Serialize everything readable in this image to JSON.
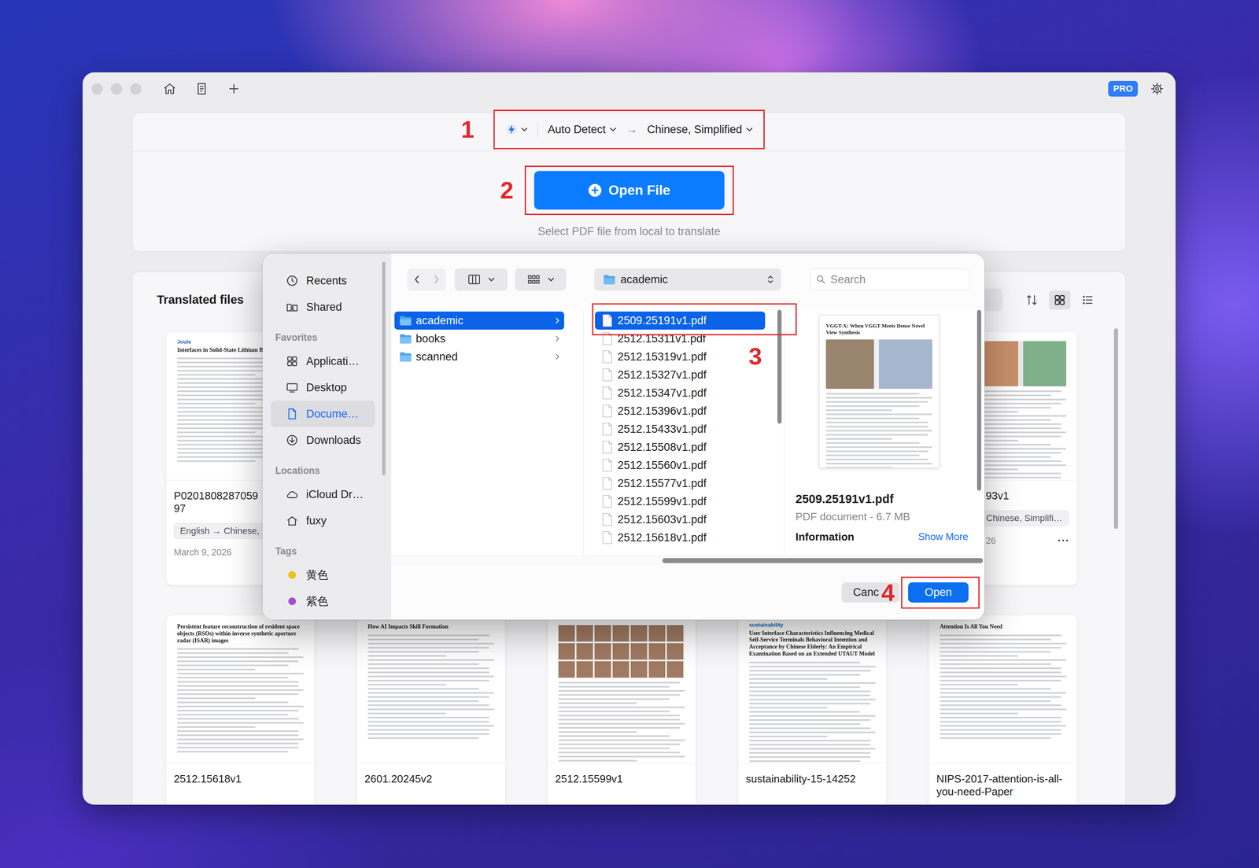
{
  "app": {
    "badge": "PRO"
  },
  "translator": {
    "source_language": "Auto Detect",
    "arrow": "→",
    "target_language": "Chinese, Simplified",
    "open_button": "Open File",
    "hint": "Select PDF file from local to translate"
  },
  "annotations": [
    {
      "label": "1"
    },
    {
      "label": "2"
    },
    {
      "label": "3"
    },
    {
      "label": "4"
    }
  ],
  "files_panel": {
    "title": "Translated files",
    "view_buttons": [
      {
        "kind": "sort",
        "selected": false
      },
      {
        "kind": "grid",
        "selected": true
      },
      {
        "kind": "list",
        "selected": false
      }
    ],
    "card_rows": [
      [
        {
          "title_lines": [
            "P0201808287059",
            "97"
          ],
          "thumb": {
            "kind": "paper",
            "header": "Joule",
            "title": "Interfaces in Solid-State Lithium Batteries"
          },
          "tag": "English → Chinese,",
          "date": "March 9, 2026"
        },
        {
          "title_lines": [
            "93v1"
          ],
          "thumb": {
            "kind": "figure"
          },
          "tag": "Chinese, Simplifi…",
          "date": "26",
          "more": "···"
        }
      ],
      [
        {
          "title_lines": [
            "2512.15618v1"
          ],
          "thumb": {
            "kind": "paper",
            "title": "Persistent feature reconstruction of resident space objects (RSOs) within inverse synthetic aperture radar (ISAR) images"
          }
        },
        {
          "title_lines": [
            "2601.20245v2"
          ],
          "thumb": {
            "kind": "paper",
            "title": "How AI Impacts Skill Formation"
          }
        },
        {
          "title_lines": [
            "2512.15599v1"
          ],
          "thumb": {
            "kind": "photo"
          }
        },
        {
          "title_lines": [
            "sustainability-15-14252"
          ],
          "thumb": {
            "kind": "paper",
            "header": "sustainability",
            "title": "User Interface Characteristics Influencing Medical Self-Service Terminals Behavioral Intention and Acceptance by Chinese Elderly: An Empirical Examination Based on an Extended UTAUT Model"
          }
        },
        {
          "title_lines": [
            "NIPS-2017-attention-is-all-",
            "you-need-Paper"
          ],
          "thumb": {
            "kind": "paper",
            "title": "Attention Is All You Need"
          }
        }
      ]
    ]
  },
  "dialog": {
    "sidebar": [
      {
        "items": [
          {
            "label": "Recents",
            "kind": "recents",
            "selected": false
          },
          {
            "label": "Shared",
            "kind": "shared",
            "selected": false
          }
        ]
      },
      {
        "heading": "Favorites",
        "items": [
          {
            "label": "Applicati…",
            "kind": "applications",
            "selected": false
          },
          {
            "label": "Desktop",
            "kind": "desktop",
            "selected": false
          },
          {
            "label": "Docume…",
            "kind": "documents",
            "selected": true
          },
          {
            "label": "Downloads",
            "kind": "downloads",
            "selected": false
          }
        ]
      },
      {
        "heading": "Locations",
        "items": [
          {
            "label": "iCloud Dr…",
            "kind": "icloud",
            "selected": false
          },
          {
            "label": "fuxy",
            "kind": "home",
            "selected": false
          }
        ]
      },
      {
        "heading": "Tags",
        "items": [
          {
            "label": "黄色",
            "kind": "tag",
            "color": "#f2c012",
            "selected": false
          },
          {
            "label": "紫色",
            "kind": "tag",
            "color": "#a24fd6",
            "selected": false
          }
        ]
      }
    ],
    "path": "academic",
    "search_placeholder": "Search",
    "folders": [
      {
        "name": "academic",
        "selected": true
      },
      {
        "name": "books",
        "selected": false
      },
      {
        "name": "scanned",
        "selected": false
      }
    ],
    "files": [
      {
        "name": "2509.25191v1.pdf",
        "selected": true
      },
      {
        "name": "2512.15311v1.pdf",
        "selected": false
      },
      {
        "name": "2512.15319v1.pdf",
        "selected": false
      },
      {
        "name": "2512.15327v1.pdf",
        "selected": false
      },
      {
        "name": "2512.15347v1.pdf",
        "selected": false
      },
      {
        "name": "2512.15396v1.pdf",
        "selected": false
      },
      {
        "name": "2512.15433v1.pdf",
        "selected": false
      },
      {
        "name": "2512.15508v1.pdf",
        "selected": false
      },
      {
        "name": "2512.15560v1.pdf",
        "selected": false
      },
      {
        "name": "2512.15577v1.pdf",
        "selected": false
      },
      {
        "name": "2512.15599v1.pdf",
        "selected": false
      },
      {
        "name": "2512.15603v1.pdf",
        "selected": false
      },
      {
        "name": "2512.15618v1.pdf",
        "selected": false
      }
    ],
    "preview": {
      "name": "2509.25191v1.pdf",
      "meta": "PDF document - 6.7 MB",
      "section": "Information",
      "link": "Show More",
      "thumb": {
        "kind": "figure",
        "title": "VGGT-X: When VGGT Meets Dense Novel View Synthesis"
      }
    },
    "buttons": [
      {
        "label": "Canc",
        "primary": false
      },
      {
        "label": "Open",
        "primary": true
      }
    ]
  }
}
